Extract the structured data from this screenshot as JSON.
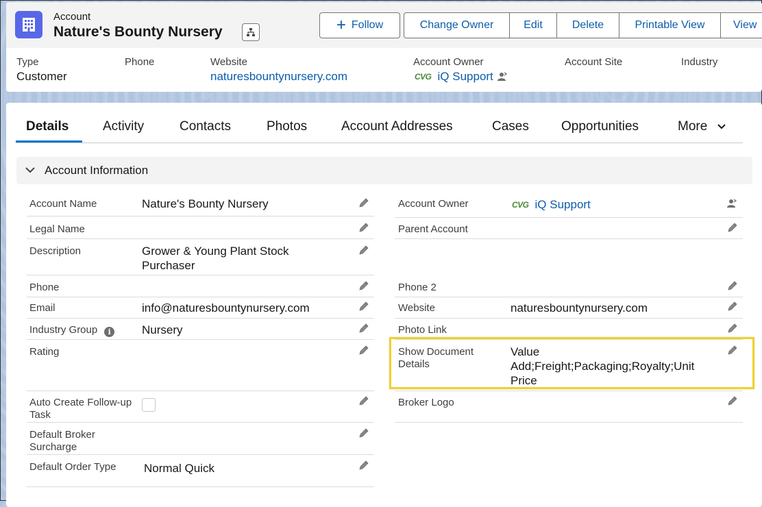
{
  "header": {
    "object_type": "Account",
    "title": "Nature's Bounty Nursery",
    "actions": {
      "follow": "Follow",
      "change_owner": "Change Owner",
      "edit": "Edit",
      "delete": "Delete",
      "printable_view": "Printable View",
      "view": "View"
    },
    "highlights": [
      {
        "label": "Type",
        "value": "Customer"
      },
      {
        "label": "Phone",
        "value": ""
      },
      {
        "label": "Website",
        "value": "naturesbountynursery.com"
      },
      {
        "label": "Account Owner",
        "value": "iQ Support",
        "logo": "CVG"
      },
      {
        "label": "Account Site",
        "value": ""
      },
      {
        "label": "Industry",
        "value": ""
      }
    ]
  },
  "tabs": [
    "Details",
    "Activity",
    "Contacts",
    "Photos",
    "Account Addresses",
    "Cases",
    "Opportunities",
    "More"
  ],
  "section": {
    "title": "Account Information"
  },
  "fields_left": [
    {
      "label": "Account Name",
      "value": "Nature's Bounty Nursery"
    },
    {
      "label": "Legal Name",
      "value": ""
    },
    {
      "label": "Description",
      "value": "Grower & Young Plant Stock Purchaser"
    },
    {
      "label": "Phone",
      "value": ""
    },
    {
      "label": "Email",
      "value": "info@naturesbountynursery.com"
    },
    {
      "label": "Industry Group",
      "value": "Nursery"
    },
    {
      "label": "Rating",
      "value": ""
    },
    {
      "label": "Auto Create Follow-up Task",
      "value": ""
    },
    {
      "label": "Default Broker Surcharge",
      "value": ""
    },
    {
      "label": "Default Order Type",
      "value": "Normal Quick"
    }
  ],
  "fields_right": [
    {
      "label": "Account Owner",
      "value": "iQ Support",
      "logo": "CVG"
    },
    {
      "label": "Parent Account",
      "value": ""
    },
    {
      "label": "Phone 2",
      "value": ""
    },
    {
      "label": "Website",
      "value": "naturesbountynursery.com"
    },
    {
      "label": "Photo Link",
      "value": ""
    },
    {
      "label": "Show Document Details",
      "value": "Value Add;Freight;Packaging;Royalty;Unit Price"
    },
    {
      "label": "Broker Logo",
      "value": ""
    }
  ],
  "colors": {
    "brand_blue": "#0176d3",
    "link": "#0b5cab",
    "account_icon": "#5867e8",
    "highlight": "#f2d02c"
  }
}
